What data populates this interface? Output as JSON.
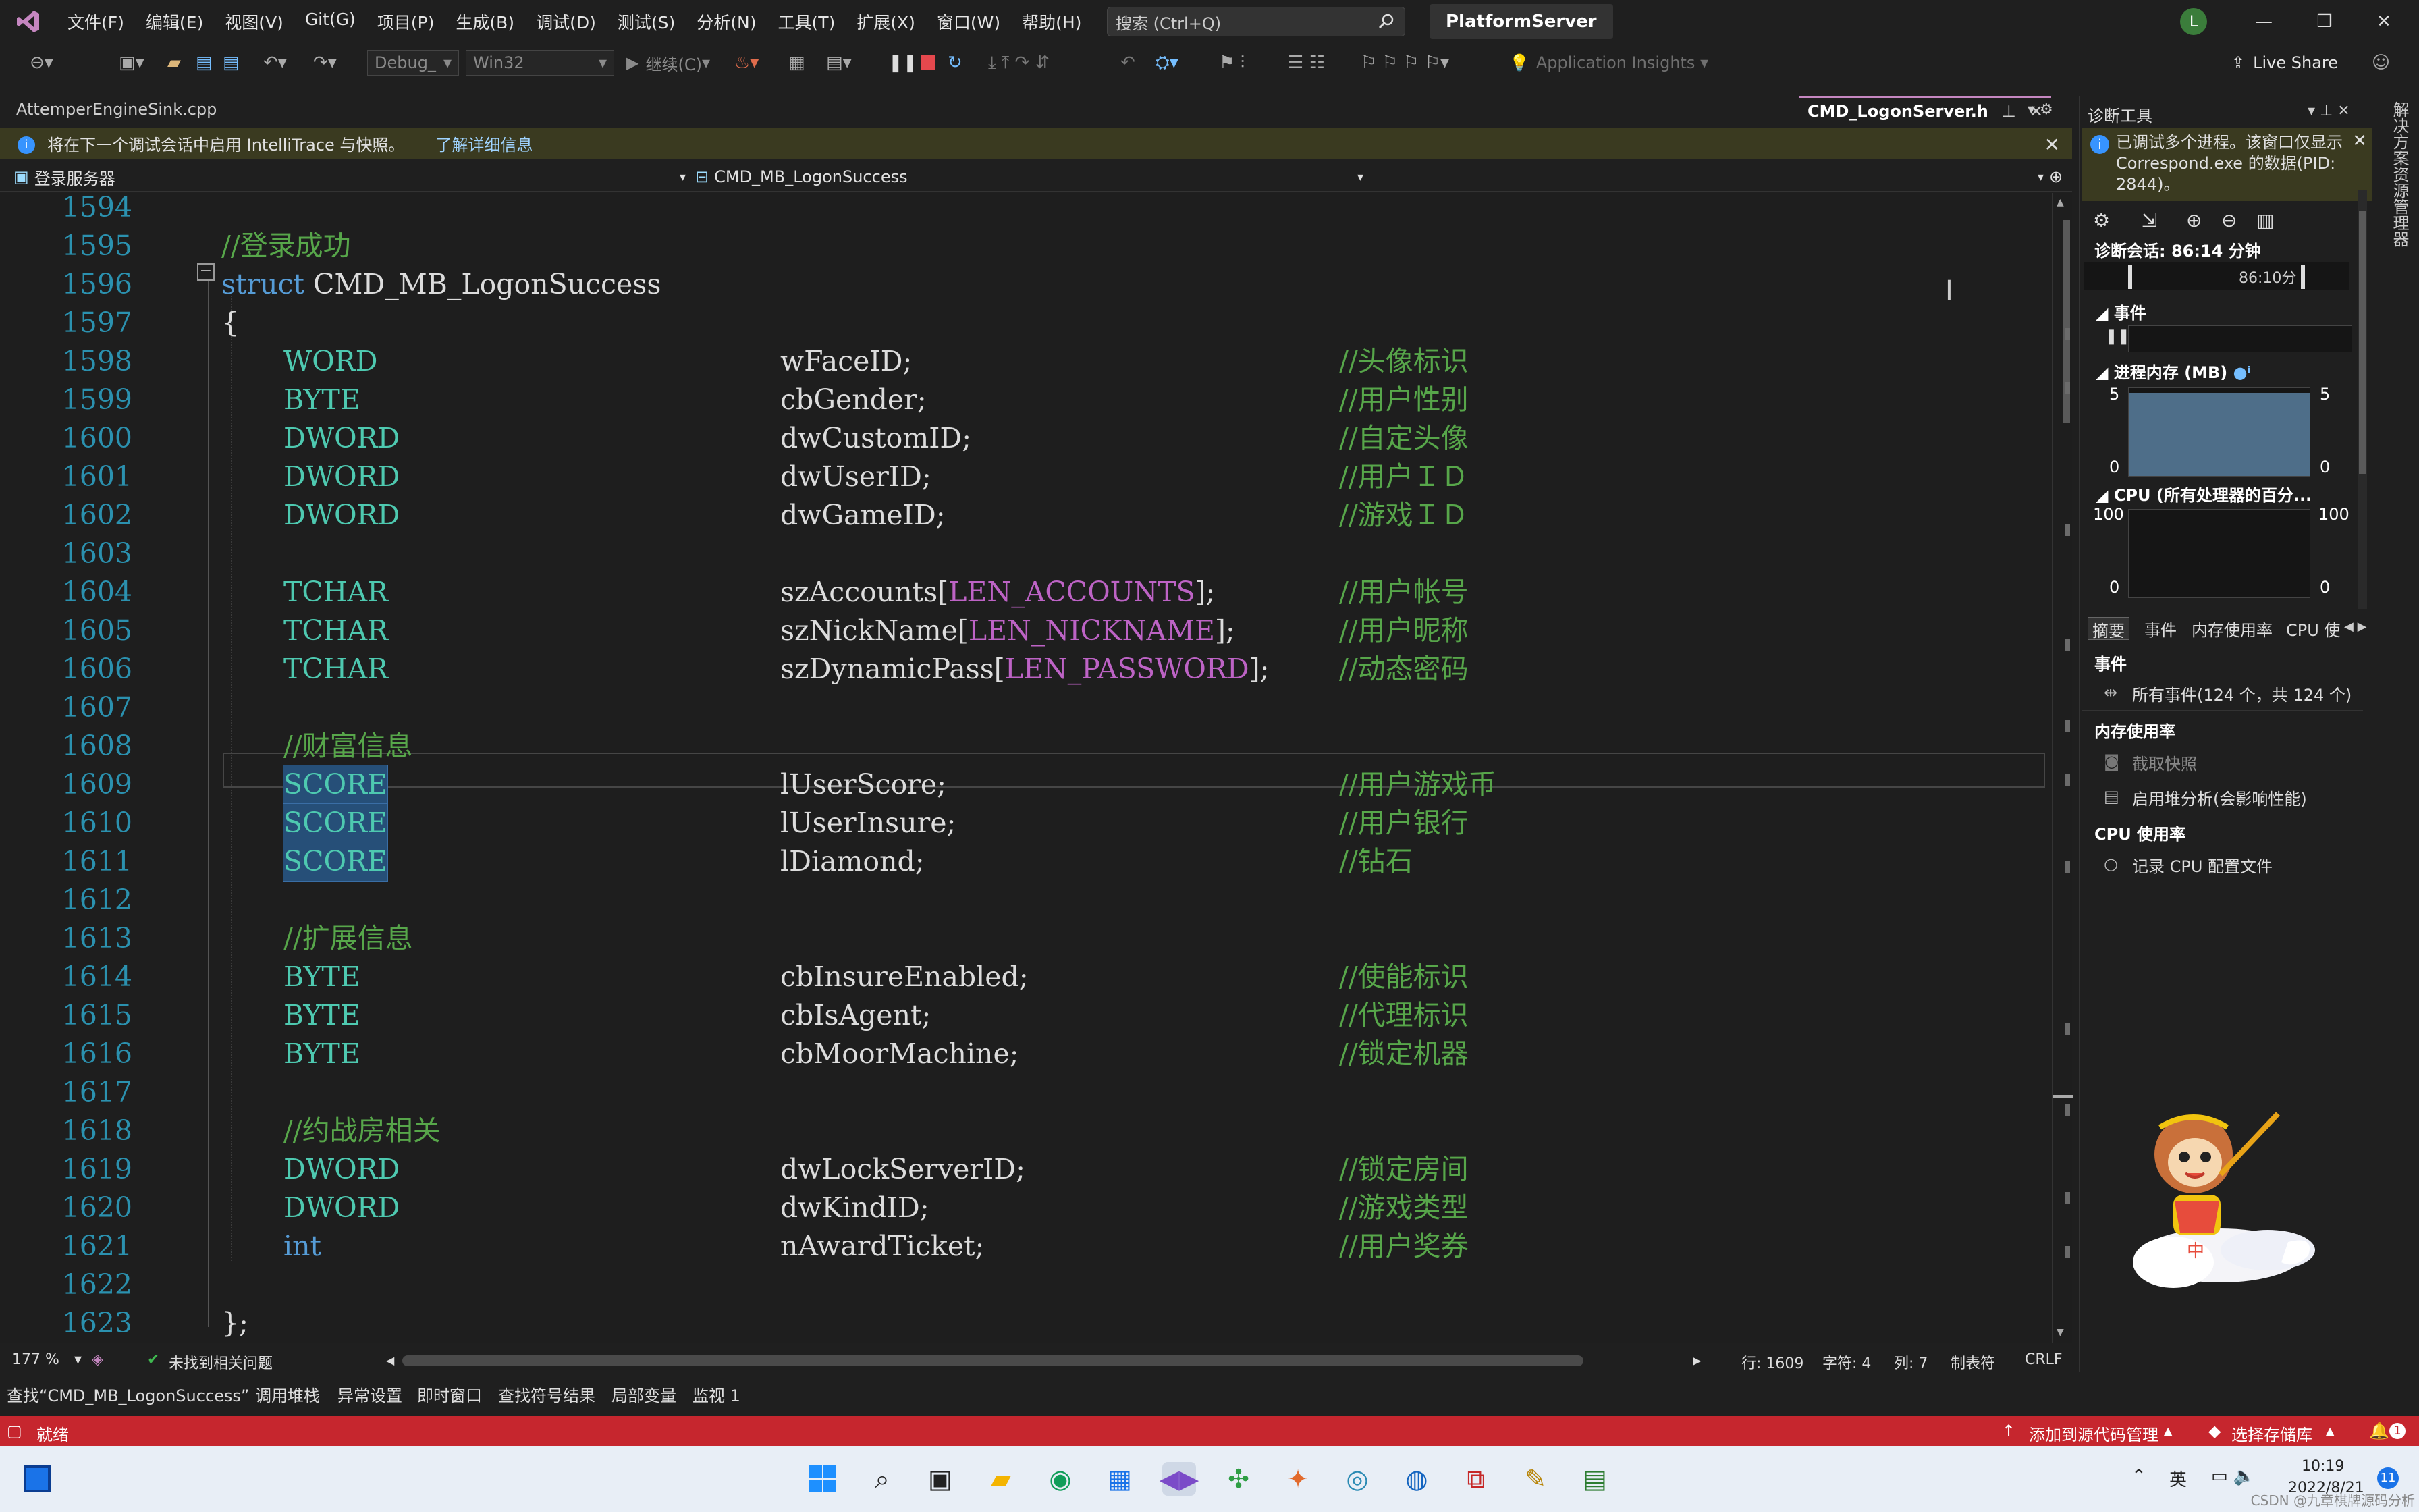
{
  "menubar": {
    "items": [
      "文件(F)",
      "编辑(E)",
      "视图(V)",
      "Git(G)",
      "项目(P)",
      "生成(B)",
      "调试(D)",
      "测试(S)",
      "分析(N)",
      "工具(T)",
      "扩展(X)",
      "窗口(W)",
      "帮助(H)"
    ],
    "search_placeholder": "搜索 (Ctrl+Q)",
    "solution_name": "PlatformServer",
    "avatar_letter": "L"
  },
  "toolbar": {
    "config": "Debug_",
    "platform": "Win32",
    "continue_label": "继续(C)",
    "app_insights": "Application Insights",
    "live_share": "Live Share"
  },
  "tabs": {
    "left_tab": "AttemperEngineSink.cpp",
    "active_tab": "CMD_LogonServer.h"
  },
  "infobar": {
    "message": "将在下一个调试会话中启用 IntelliTrace 与快照。",
    "link": "了解详细信息"
  },
  "navbar": {
    "project": "登录服务器",
    "scope": "CMD_MB_LogonSuccess"
  },
  "editor": {
    "partial_top": "1594",
    "partial_bottom": "1624",
    "lines": [
      {
        "n": "1595",
        "c1": "",
        "c2": "",
        "c3": "",
        "full": "//登录成功",
        "kind": "comment-full"
      },
      {
        "n": "1596",
        "kw": "struct",
        "name": "CMD_MB_LogonSuccess",
        "kind": "struct"
      },
      {
        "n": "1597",
        "full": "{",
        "kind": "brace"
      },
      {
        "n": "1598",
        "c1": "WORD",
        "c2": "wFaceID;",
        "c3": "//头像标识"
      },
      {
        "n": "1599",
        "c1": "BYTE",
        "c2": "cbGender;",
        "c3": "//用户性别"
      },
      {
        "n": "1600",
        "c1": "DWORD",
        "c2": "dwCustomID;",
        "c3": "//自定头像"
      },
      {
        "n": "1601",
        "c1": "DWORD",
        "c2": "dwUserID;",
        "c3": "//用户ＩＤ"
      },
      {
        "n": "1602",
        "c1": "DWORD",
        "c2": "dwGameID;",
        "c3": "//游戏ＩＤ"
      },
      {
        "n": "1603",
        "kind": "empty"
      },
      {
        "n": "1604",
        "c1": "TCHAR",
        "c2a": "szAccounts[",
        "macro": "LEN_ACCOUNTS",
        "c2b": "];",
        "c3": "//用户帐号"
      },
      {
        "n": "1605",
        "c1": "TCHAR",
        "c2a": "szNickName[",
        "macro": "LEN_NICKNAME",
        "c2b": "];",
        "c3": "//用户昵称"
      },
      {
        "n": "1606",
        "c1": "TCHAR",
        "c2a": "szDynamicPass[",
        "macro": "LEN_PASSWORD",
        "c2b": "];",
        "c3": "//动态密码"
      },
      {
        "n": "1607",
        "kind": "empty"
      },
      {
        "n": "1608",
        "full": "//财富信息",
        "kind": "comment-indent"
      },
      {
        "n": "1609",
        "c1": "SCORE",
        "c2": "lUserScore;",
        "c3": "//用户游戏币",
        "sel": true
      },
      {
        "n": "1610",
        "c1": "SCORE",
        "c2": "lUserInsure;",
        "c3": "//用户银行",
        "sel": true
      },
      {
        "n": "1611",
        "c1": "SCORE",
        "c2": "lDiamond;",
        "c3": "//钻石",
        "sel": true
      },
      {
        "n": "1612",
        "kind": "empty"
      },
      {
        "n": "1613",
        "full": "//扩展信息",
        "kind": "comment-indent"
      },
      {
        "n": "1614",
        "c1": "BYTE",
        "c2": "cbInsureEnabled;",
        "c3": "//使能标识"
      },
      {
        "n": "1615",
        "c1": "BYTE",
        "c2": "cbIsAgent;",
        "c3": "//代理标识"
      },
      {
        "n": "1616",
        "c1": "BYTE",
        "c2": "cbMoorMachine;",
        "c3": "//锁定机器"
      },
      {
        "n": "1617",
        "kind": "empty"
      },
      {
        "n": "1618",
        "full": "//约战房相关",
        "kind": "comment-indent"
      },
      {
        "n": "1619",
        "c1": "DWORD",
        "c2": "dwLockServerID;",
        "c3": "//锁定房间"
      },
      {
        "n": "1620",
        "c1": "DWORD",
        "c2": "dwKindID;",
        "c3": "//游戏类型"
      },
      {
        "n": "1621",
        "c1": "int",
        "c2": "nAwardTicket;",
        "c3": "//用户奖券",
        "kwtype": true
      },
      {
        "n": "1622",
        "kind": "empty"
      },
      {
        "n": "1623",
        "full": "};",
        "kind": "brace"
      }
    ]
  },
  "editor_status": {
    "zoom": "177 %",
    "issues": "未找到相关问题",
    "line": "行: 1609",
    "char": "字符: 4",
    "col": "列: 7",
    "tabs": "制表符",
    "eol": "CRLF"
  },
  "tool_tabs": [
    "查找“CMD_MB_LogonSuccess”",
    "调用堆栈",
    "异常设置",
    "即时窗口",
    "查找符号结果",
    "局部变量",
    "监视 1"
  ],
  "statusbar": {
    "ready": "就绪",
    "source_control": "添加到源代码管理",
    "repo": "选择存储库",
    "notifications": "1"
  },
  "diag": {
    "title": "诊断工具",
    "info": "已调试多个进程。该窗口仅显示 Correspond.exe 的数据(PID: 2844)。",
    "session": "诊断会话: 86:14 分钟",
    "timeline_end": "86:10分",
    "events_header": "事件",
    "memory_header": "进程内存 (MB)",
    "memory_max": "5",
    "memory_min": "0",
    "memory_level": 0.95,
    "cpu_header": "CPU (所有处理器的百分...",
    "cpu_max": "100",
    "cpu_min": "0",
    "tabs": [
      "摘要",
      "事件",
      "内存使用率",
      "CPU 使"
    ],
    "events_title": "事件",
    "all_events": "所有事件(124 个，共 124 个)",
    "mem_title": "内存使用率",
    "snapshot": "截取快照",
    "heap": "启用堆分析(会影响性能)",
    "cpu_title": "CPU 使用率",
    "cpu_record": "记录 CPU 配置文件"
  },
  "side_strip": "解决方案资源管理器",
  "taskbar": {
    "ime": "英",
    "time": "10:19",
    "date": "2022/8/21",
    "notif_count": "11",
    "watermark": "CSDN @九章棋牌源码分析"
  }
}
